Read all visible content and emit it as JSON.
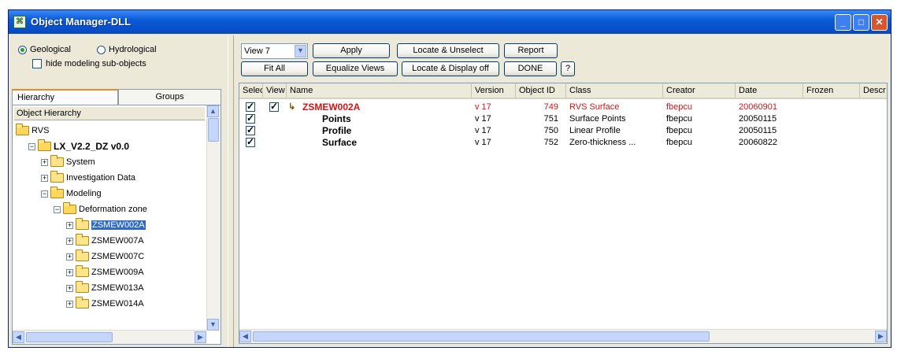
{
  "window": {
    "title": "Object Manager-DLL",
    "icon": "app-icon"
  },
  "left": {
    "radio_geological": "Geological",
    "radio_hydrological": "Hydrological",
    "hide_modeling": "hide modeling sub-objects",
    "tabs": [
      "Hierarchy",
      "Groups"
    ],
    "tree_header": "Object Hierarchy",
    "tree": [
      {
        "label": "RVS",
        "level": 0,
        "open": true,
        "bold": false
      },
      {
        "label": "LX_V2.2_DZ  v0.0",
        "level": 1,
        "open": true,
        "bold": true,
        "toggle": "−"
      },
      {
        "label": "System",
        "level": 2,
        "open": false,
        "toggle": "+"
      },
      {
        "label": "Investigation Data",
        "level": 2,
        "open": false,
        "toggle": "+"
      },
      {
        "label": "Modeling",
        "level": 2,
        "open": true,
        "toggle": "−"
      },
      {
        "label": "Deformation zone",
        "level": 3,
        "open": true,
        "toggle": "−"
      },
      {
        "label": "ZSMEW002A",
        "level": 4,
        "open": false,
        "toggle": "+",
        "selected": true
      },
      {
        "label": "ZSMEW007A",
        "level": 4,
        "open": false,
        "toggle": "+"
      },
      {
        "label": "ZSMEW007C",
        "level": 4,
        "open": false,
        "toggle": "+"
      },
      {
        "label": "ZSMEW009A",
        "level": 4,
        "open": false,
        "toggle": "+"
      },
      {
        "label": "ZSMEW013A",
        "level": 4,
        "open": false,
        "toggle": "+"
      },
      {
        "label": "ZSMEW014A",
        "level": 4,
        "open": false,
        "toggle": "+"
      }
    ]
  },
  "toolbar": {
    "view_select": "View 7",
    "apply": "Apply",
    "locate_unselect": "Locate & Unselect",
    "report": "Report",
    "fit_all": "Fit All",
    "equalize_views": "Equalize Views",
    "locate_display_off": "Locate & Display off",
    "done": "DONE",
    "help": "?"
  },
  "list": {
    "columns": [
      "Selec",
      "View",
      "Name",
      "Version",
      "Object ID",
      "Class",
      "Creator",
      "Date",
      "Frozen",
      "Descr"
    ],
    "rows": [
      {
        "sel": true,
        "view": true,
        "name": "ZSMEW002A",
        "version": "v 17",
        "object_id": "749",
        "class": "RVS Surface",
        "creator": "fbepcu",
        "date": "20060901",
        "highlight": true
      },
      {
        "sel": true,
        "view": false,
        "name": "Points",
        "version": "v 17",
        "object_id": "751",
        "class": "Surface Points",
        "creator": "fbepcu",
        "date": "20050115",
        "highlight": false
      },
      {
        "sel": true,
        "view": false,
        "name": "Profile",
        "version": "v 17",
        "object_id": "750",
        "class": "Linear Profile",
        "creator": "fbepcu",
        "date": "20050115",
        "highlight": false
      },
      {
        "sel": true,
        "view": false,
        "name": "Surface",
        "version": "v 17",
        "object_id": "752",
        "class": "Zero-thickness ...",
        "creator": "fbepcu",
        "date": "20060822",
        "highlight": false
      }
    ]
  },
  "colors": {
    "accent_red": "#d41414",
    "selection": "#316ac5",
    "titlebar": "#0a5bd6"
  }
}
